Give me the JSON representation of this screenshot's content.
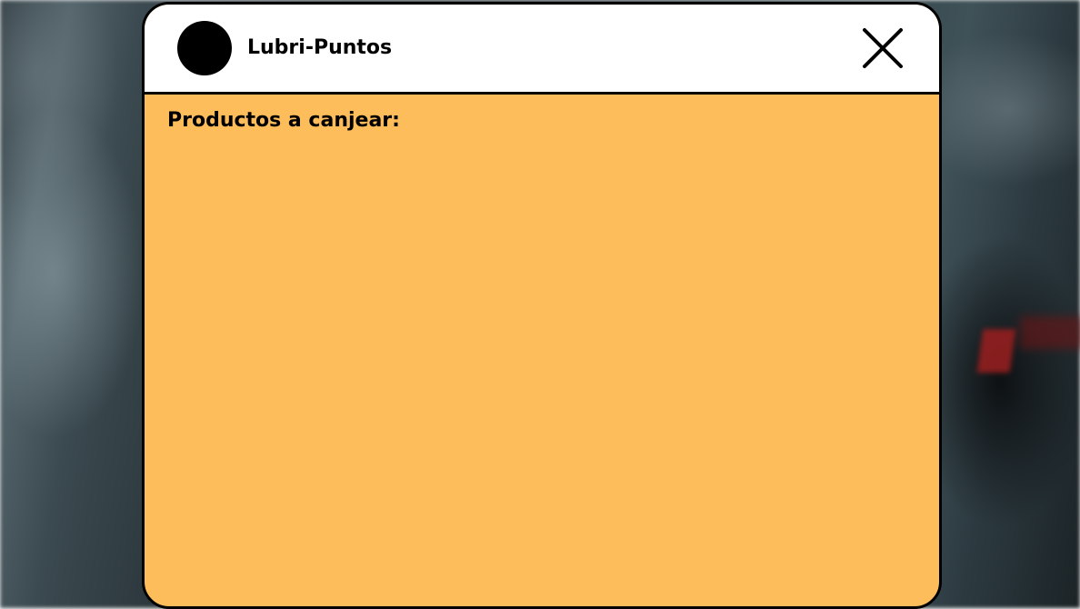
{
  "window": {
    "title": "Lubri-Puntos",
    "accent_color": "#fdbd5b",
    "header_color": "#ffffff",
    "border_color": "#000000"
  },
  "header": {
    "logo_icon": "circle-logo-icon",
    "close_icon": "close-icon"
  },
  "body": {
    "section_title": "Productos a canjear:",
    "products": []
  }
}
